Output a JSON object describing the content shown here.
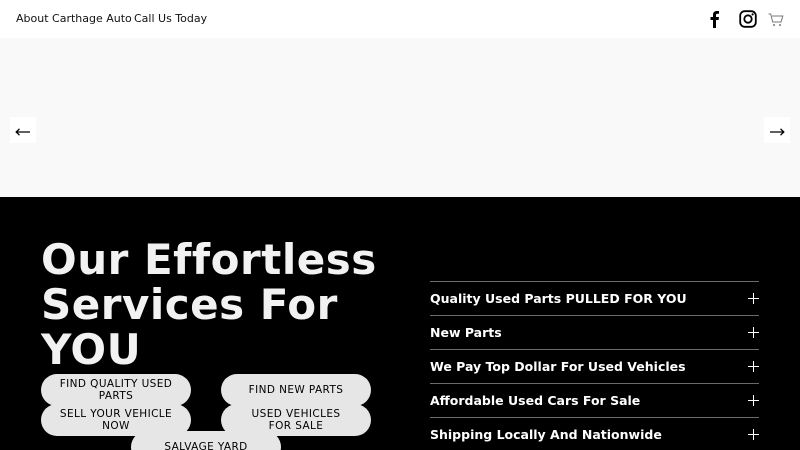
{
  "nav": {
    "links": [
      "About Carthage Auto",
      "Call Us Today"
    ]
  },
  "icons": {
    "facebook": "facebook-icon",
    "instagram": "instagram-icon",
    "cart": "cart-icon",
    "prev": "arrow-left-icon",
    "next": "arrow-right-icon",
    "expand": "plus-icon"
  },
  "services": {
    "heading": "Our Effortless Services For YOU",
    "buttons": [
      "FIND QUALITY USED PARTS",
      "FIND NEW PARTS",
      "SELL YOUR VEHICLE NOW",
      "USED VEHICLES FOR SALE",
      "SALVAGE YARD"
    ],
    "accordion": [
      "Quality Used Parts PULLED FOR YOU",
      "New Parts",
      "We Pay Top Dollar For Used Vehicles",
      "Affordable Used Cars For Sale",
      "Shipping Locally And Nationwide"
    ]
  },
  "colors": {
    "dark_section": "#000000",
    "hero_bg": "#f9f9f9",
    "pill_bg": "#e6e6e6"
  }
}
